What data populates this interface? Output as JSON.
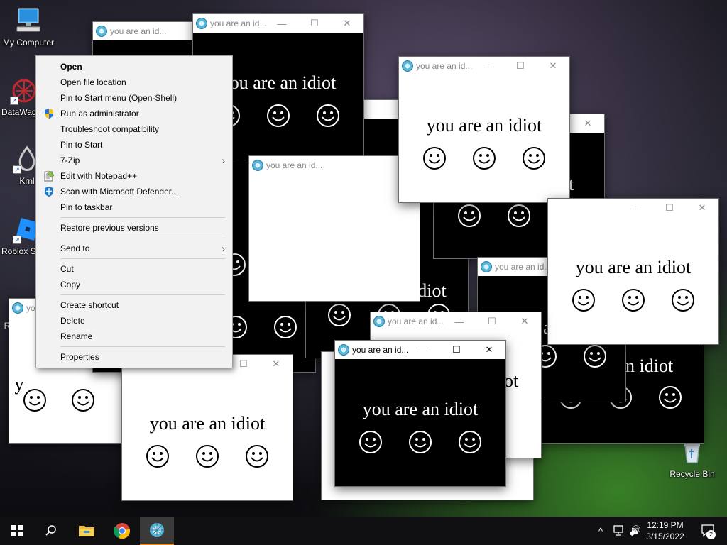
{
  "desktop": {
    "icons": [
      {
        "label": "My Computer",
        "icon": "computer-icon"
      },
      {
        "label": "DataWag",
        "icon": "datawag-icon"
      },
      {
        "label": "Krnl",
        "icon": "krnl-icon"
      },
      {
        "label": "Roblox St",
        "icon": "roblox-studio-icon"
      },
      {
        "label": "Recycle Bin",
        "icon": "recycle-bin-icon"
      }
    ],
    "partial_label": "R"
  },
  "popup": {
    "title": "you are an id...",
    "message": "you are an idiot",
    "face": "☺",
    "title_controls": {
      "minimize": "—",
      "maximize": "☐",
      "close": "✕"
    }
  },
  "popup_fragments": {
    "title_short": "yo",
    "idiot": "idiot",
    "ot": "ot",
    "tail_t": "t",
    "n_idiot": "n idiot",
    "a": "a",
    "ar": "ar",
    "left_y": "y"
  },
  "context_menu": {
    "items": [
      {
        "label": "Open",
        "bold": true
      },
      {
        "label": "Open file location"
      },
      {
        "label": "Pin to Start menu (Open-Shell)"
      },
      {
        "label": "Run as administrator",
        "icon": "uac-shield-icon"
      },
      {
        "label": "Troubleshoot compatibility"
      },
      {
        "label": "Pin to Start"
      },
      {
        "label": "7-Zip",
        "submenu": true
      },
      {
        "label": "Edit with Notepad++",
        "icon": "notepad-plus-plus-icon"
      },
      {
        "label": "Scan with Microsoft Defender...",
        "icon": "defender-icon"
      },
      {
        "label": "Pin to taskbar"
      },
      {
        "separator": true
      },
      {
        "label": "Restore previous versions"
      },
      {
        "separator": true
      },
      {
        "label": "Send to",
        "submenu": true
      },
      {
        "separator": true
      },
      {
        "label": "Cut"
      },
      {
        "label": "Copy"
      },
      {
        "separator": true
      },
      {
        "label": "Create shortcut"
      },
      {
        "label": "Delete"
      },
      {
        "label": "Rename"
      },
      {
        "separator": true
      },
      {
        "label": "Properties"
      }
    ],
    "submenu_arrow": "›"
  },
  "taskbar": {
    "time": "12:19 PM",
    "date": "3/15/2022",
    "notification_count": "2",
    "tray_chevron": "^",
    "volume_glyph": "🔊"
  },
  "colors": {
    "accent_active_task": "#e38c24",
    "menu_background": "#f2f2f2"
  }
}
